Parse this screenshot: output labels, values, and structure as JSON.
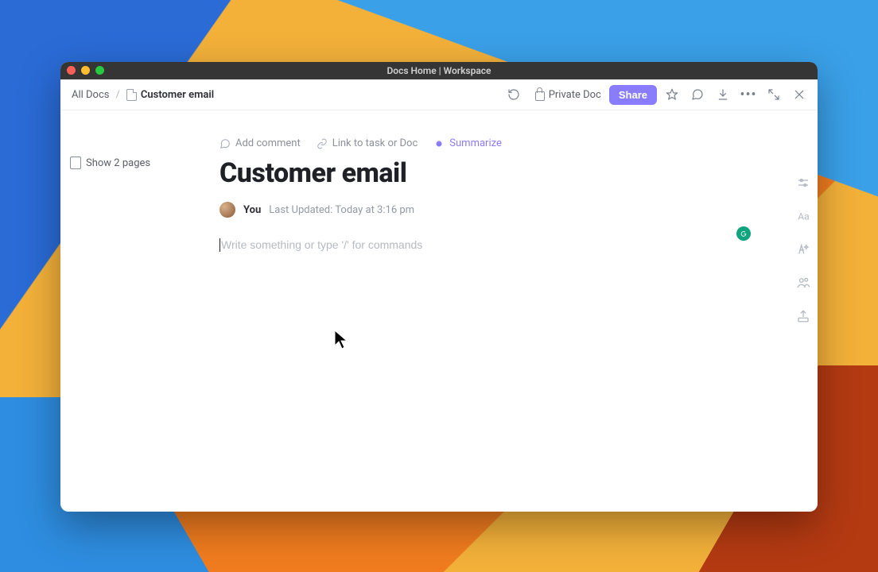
{
  "window": {
    "title": "Docs Home | Workspace"
  },
  "breadcrumb": {
    "root": "All Docs",
    "current": "Customer email"
  },
  "toolbar": {
    "private_label": "Private Doc",
    "share_label": "Share"
  },
  "sidebar": {
    "show_pages_label": "Show 2 pages"
  },
  "actions": {
    "add_comment": "Add comment",
    "link_task": "Link to task or Doc",
    "summarize": "Summarize"
  },
  "doc": {
    "title": "Customer email",
    "author": "You",
    "updated_label": "Last Updated:",
    "updated_value": "Today at 3:16 pm",
    "placeholder": "Write something or type '/' for commands"
  },
  "rightrail": {
    "items": [
      "settings-toggle",
      "text-style",
      "ai-assist",
      "collab",
      "export"
    ]
  }
}
